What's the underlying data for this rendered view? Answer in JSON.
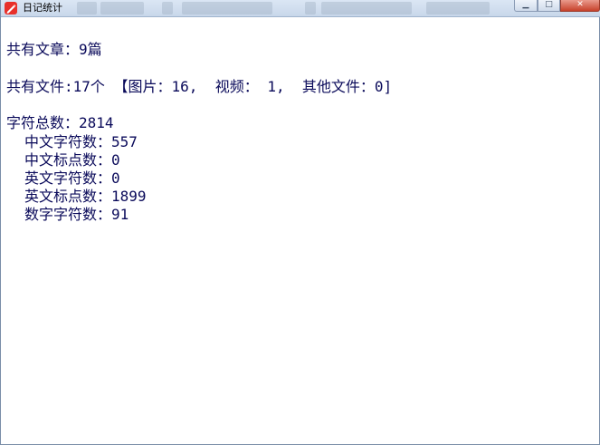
{
  "window": {
    "title": "日记统计",
    "controls": {
      "minimize_icon": "minimize-icon",
      "maximize_icon": "maximize-icon",
      "close_icon": "close-icon"
    }
  },
  "stats": {
    "articles": "共有文章：9篇",
    "files": "共有文件:17个 【图片：16,  视频： 1,  其他文件：0]",
    "chars_total": "字符总数：2814",
    "details": [
      "中文字符数：557",
      "中文标点数：0",
      "英文字符数：0",
      "英文标点数：1899",
      "数字字符数：91"
    ]
  },
  "colors": {
    "text": "#0a0a5a",
    "titlebar": "#c8d7ea",
    "app_icon": "#e8302a",
    "close_button": "#c7412b"
  }
}
